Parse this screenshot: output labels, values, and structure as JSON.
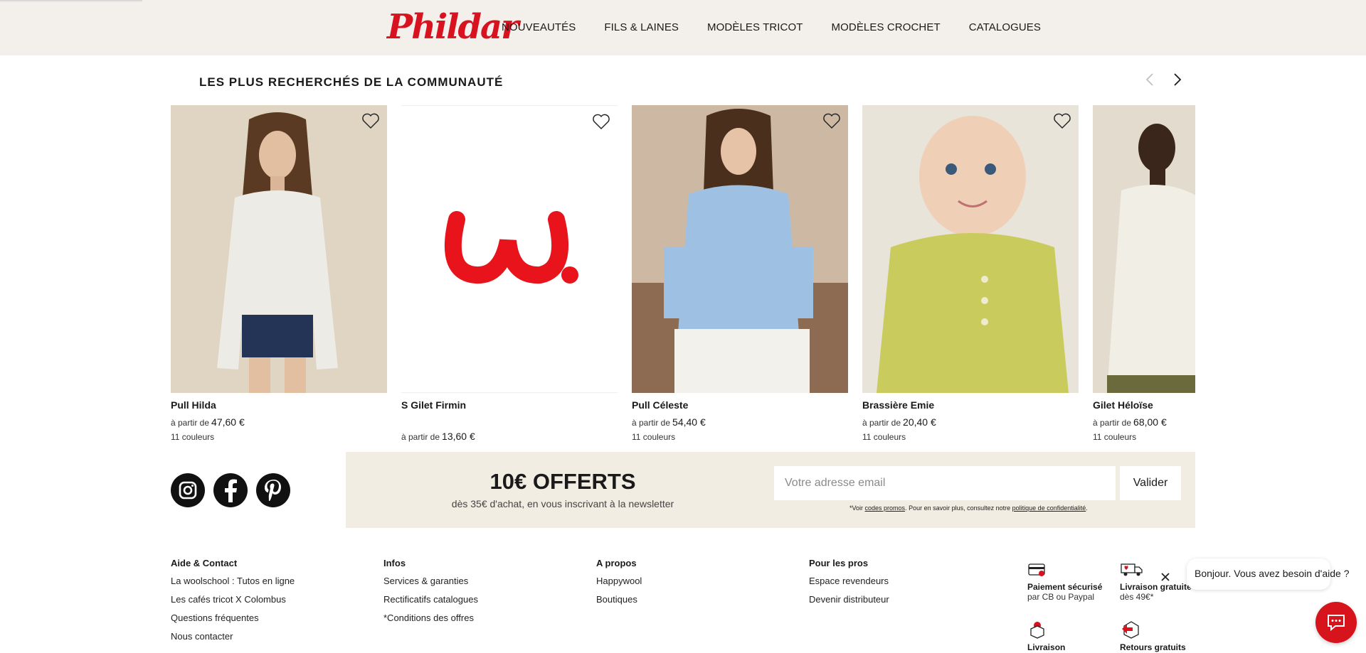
{
  "brand": {
    "logo": "Phildar",
    "color": "#d9121f"
  },
  "nav": {
    "items": [
      "NOUVEAUTÉS",
      "FILS & LAINES",
      "MODÈLES TRICOT",
      "MODÈLES CROCHET",
      "CATALOGUES"
    ]
  },
  "section": {
    "title": "LES PLUS RECHERCHÉS DE LA COMMUNAUTÉ",
    "prev_icon": "chevron-left-icon",
    "next_icon": "chevron-right-icon"
  },
  "products": [
    {
      "name": "Pull Hilda",
      "price_prefix": "à partir de",
      "price": "47,60 €",
      "colors": "11 couleurs"
    },
    {
      "name": "S Gilet Firmin",
      "price_prefix": "à partir de",
      "price": "13,60 €",
      "colors": ""
    },
    {
      "name": "Pull Céleste",
      "price_prefix": "à partir de",
      "price": "54,40 €",
      "colors": "11 couleurs"
    },
    {
      "name": "Brassière Emie",
      "price_prefix": "à partir de",
      "price": "20,40 €",
      "colors": "11 couleurs"
    },
    {
      "name": "Gilet Héloïse",
      "price_prefix": "à partir de",
      "price": "68,00 €",
      "colors": "11 couleurs"
    }
  ],
  "social": {
    "icons": [
      "instagram-icon",
      "facebook-icon",
      "pinterest-icon"
    ]
  },
  "newsletter": {
    "title": "10€ OFFERTS",
    "subtitle": "dès 35€ d'achat, en vous inscrivant à la newsletter",
    "placeholder": "Votre adresse email",
    "button": "Valider",
    "note_prefix": "*Voir",
    "note_link1": "codes promos",
    "note_middle": ". Pour en savoir plus, consultez notre",
    "note_link2": "politique de confidentialité",
    "note_suffix": "."
  },
  "footer": {
    "columns": [
      {
        "title": "Aide & Contact",
        "links": [
          "La woolschool : Tutos en ligne",
          "Les cafés tricot X Colombus",
          "Questions fréquentes",
          "Nous contacter"
        ]
      },
      {
        "title": "Infos",
        "links": [
          "Services & garanties",
          "Rectificatifs catalogues",
          "*Conditions des offres"
        ]
      },
      {
        "title": "A propos",
        "links": [
          "Happywool",
          "Boutiques"
        ]
      },
      {
        "title": "Pour les pros",
        "links": [
          "Espace revendeurs",
          "Devenir distributeur"
        ]
      }
    ],
    "features": [
      {
        "title": "Paiement sécurisé",
        "sub": "par CB ou Paypal",
        "icon": "card-icon"
      },
      {
        "title": "Livraison gratuite",
        "sub": "dès 49€*",
        "icon": "truck-icon"
      },
      {
        "title": "Livraison",
        "sub": "",
        "icon": "package-icon"
      },
      {
        "title": "Retours gratuits",
        "sub": "",
        "icon": "return-icon"
      }
    ]
  },
  "chat": {
    "message": "Bonjour. Vous avez besoin d'aide ?",
    "close_icon": "close-icon",
    "button_icon": "chat-icon"
  }
}
